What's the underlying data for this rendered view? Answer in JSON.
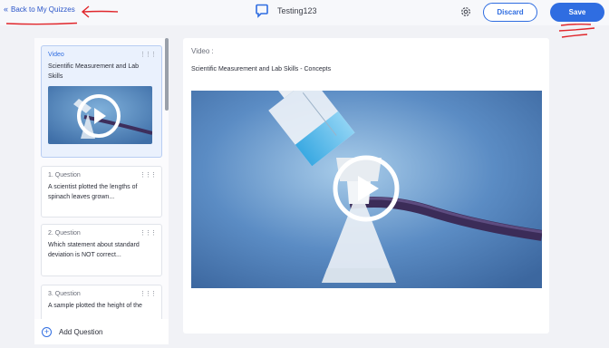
{
  "header": {
    "back_label": "Back to My Quizzes",
    "quiz_title": "Testing123",
    "discard_label": "Discard",
    "save_label": "Save"
  },
  "sidebar": {
    "items": [
      {
        "kind": "Video",
        "text": "Scientific Measurement and Lab Skills"
      },
      {
        "kind": "1. Question",
        "text": "A scientist plotted the lengths of spinach leaves grown..."
      },
      {
        "kind": "2. Question",
        "text": "Which statement about standard deviation is NOT correct..."
      },
      {
        "kind": "3. Question",
        "text": "A sample plotted the height of the"
      }
    ],
    "add_question_label": "Add Question"
  },
  "main": {
    "label": "Video :",
    "title": "Scientific Measurement and Lab Skills - Concepts"
  },
  "colors": {
    "accent": "#2f6de1",
    "annotation_red": "#e0262b",
    "video_bg": "#4f7fb8"
  },
  "icons": [
    "back-chevron-icon",
    "chat-bubble-logo-icon",
    "gear-icon",
    "drag-dots-icon",
    "play-icon",
    "plus-circle-icon"
  ]
}
